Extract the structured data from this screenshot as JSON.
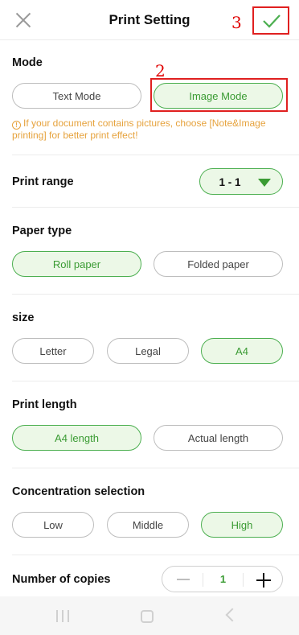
{
  "header": {
    "title": "Print Setting",
    "annotation_confirm": "3"
  },
  "mode": {
    "title": "Mode",
    "options": [
      "Text Mode",
      "Image Mode"
    ],
    "selected": "Image Mode",
    "annotation": "2",
    "info_text": "If your document contains pictures, choose [Note&Image printing] for better print effect!"
  },
  "print_range": {
    "title": "Print range",
    "value": "1 - 1"
  },
  "paper_type": {
    "title": "Paper type",
    "options": [
      "Roll paper",
      "Folded paper"
    ],
    "selected": "Roll paper"
  },
  "size": {
    "title": "size",
    "options": [
      "Letter",
      "Legal",
      "A4"
    ],
    "selected": "A4"
  },
  "print_length": {
    "title": "Print length",
    "options": [
      "A4 length",
      "Actual length"
    ],
    "selected": "A4 length"
  },
  "concentration": {
    "title": "Concentration selection",
    "options": [
      "Low",
      "Middle",
      "High"
    ],
    "selected": "High"
  },
  "copies": {
    "title": "Number of copies",
    "value": "1"
  },
  "colors": {
    "accent": "#4caf50",
    "accent_bg": "#ecf8e7",
    "info": "#e6a23c",
    "annotation": "#e02020"
  }
}
